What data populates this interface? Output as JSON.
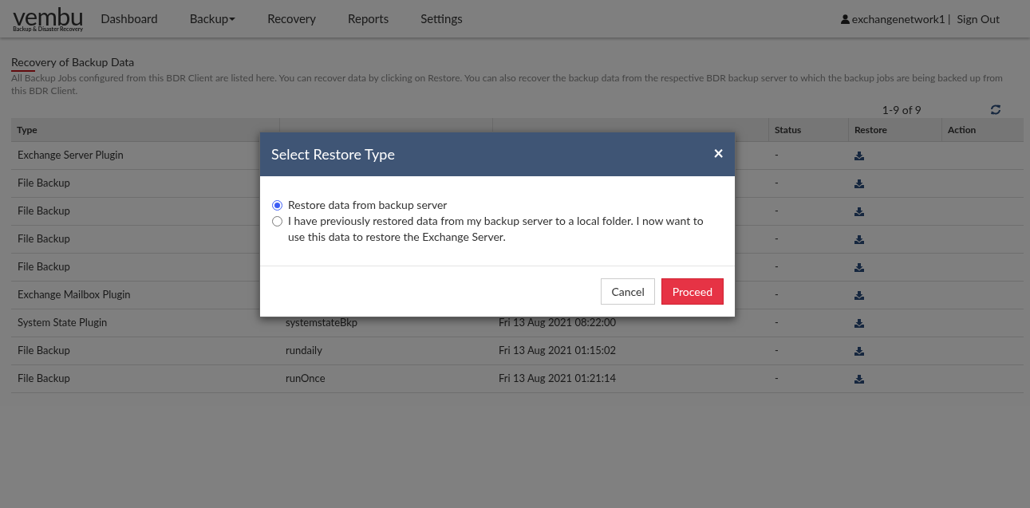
{
  "logo": {
    "name": "vembu",
    "tagline": "Backup & Disaster Recovery"
  },
  "nav": [
    {
      "label": "Dashboard",
      "has_menu": false
    },
    {
      "label": "Backup",
      "has_menu": true
    },
    {
      "label": "Recovery",
      "has_menu": false
    },
    {
      "label": "Reports",
      "has_menu": false
    },
    {
      "label": "Settings",
      "has_menu": false
    }
  ],
  "user": {
    "name": "exchangenetwork1",
    "separator": "|",
    "sign_out": "Sign Out"
  },
  "page": {
    "title": "Recovery of Backup Data",
    "description": "All Backup Jobs configured from this BDR Client are listed here. You can recover data by clicking on Restore. You can also recover the backup data from the respective BDR backup server to which the backup jobs are being backed up from this BDR Client."
  },
  "pagination": "1-9 of 9",
  "table": {
    "columns": [
      "Type",
      "Status",
      "Restore",
      "Action"
    ],
    "rows": [
      {
        "type": "Exchange Server Plugin",
        "status": "-"
      },
      {
        "type": "File Backup",
        "status": "-"
      },
      {
        "type": "File Backup",
        "status": "-"
      },
      {
        "type": "File Backup",
        "status": "-"
      },
      {
        "type": "File Backup",
        "status": "-"
      },
      {
        "type": "Exchange Mailbox Plugin",
        "status": "-"
      },
      {
        "type": "System State Plugin",
        "job_name": "systemstateBkp",
        "last_backup_time": "Fri 13 Aug 2021 08:22:00",
        "status": "-"
      },
      {
        "type": "File Backup",
        "job_name": "rundaily",
        "last_backup_time": "Fri 13 Aug 2021 01:15:02",
        "status": "-"
      },
      {
        "type": "File Backup",
        "job_name": "runOnce",
        "last_backup_time": "Fri 13 Aug 2021 01:21:14",
        "status": "-"
      }
    ]
  },
  "dialog": {
    "title": "Select Restore Type",
    "close": "×",
    "options": [
      {
        "label": "Restore data from backup server",
        "selected": true
      },
      {
        "label": "I have previously restored data from my backup server to a local folder. I now want to use this data to restore the Exchange Server.",
        "selected": false
      }
    ],
    "buttons": [
      {
        "label": "Cancel",
        "kind": "default"
      },
      {
        "label": "Proceed",
        "kind": "primary"
      }
    ]
  }
}
